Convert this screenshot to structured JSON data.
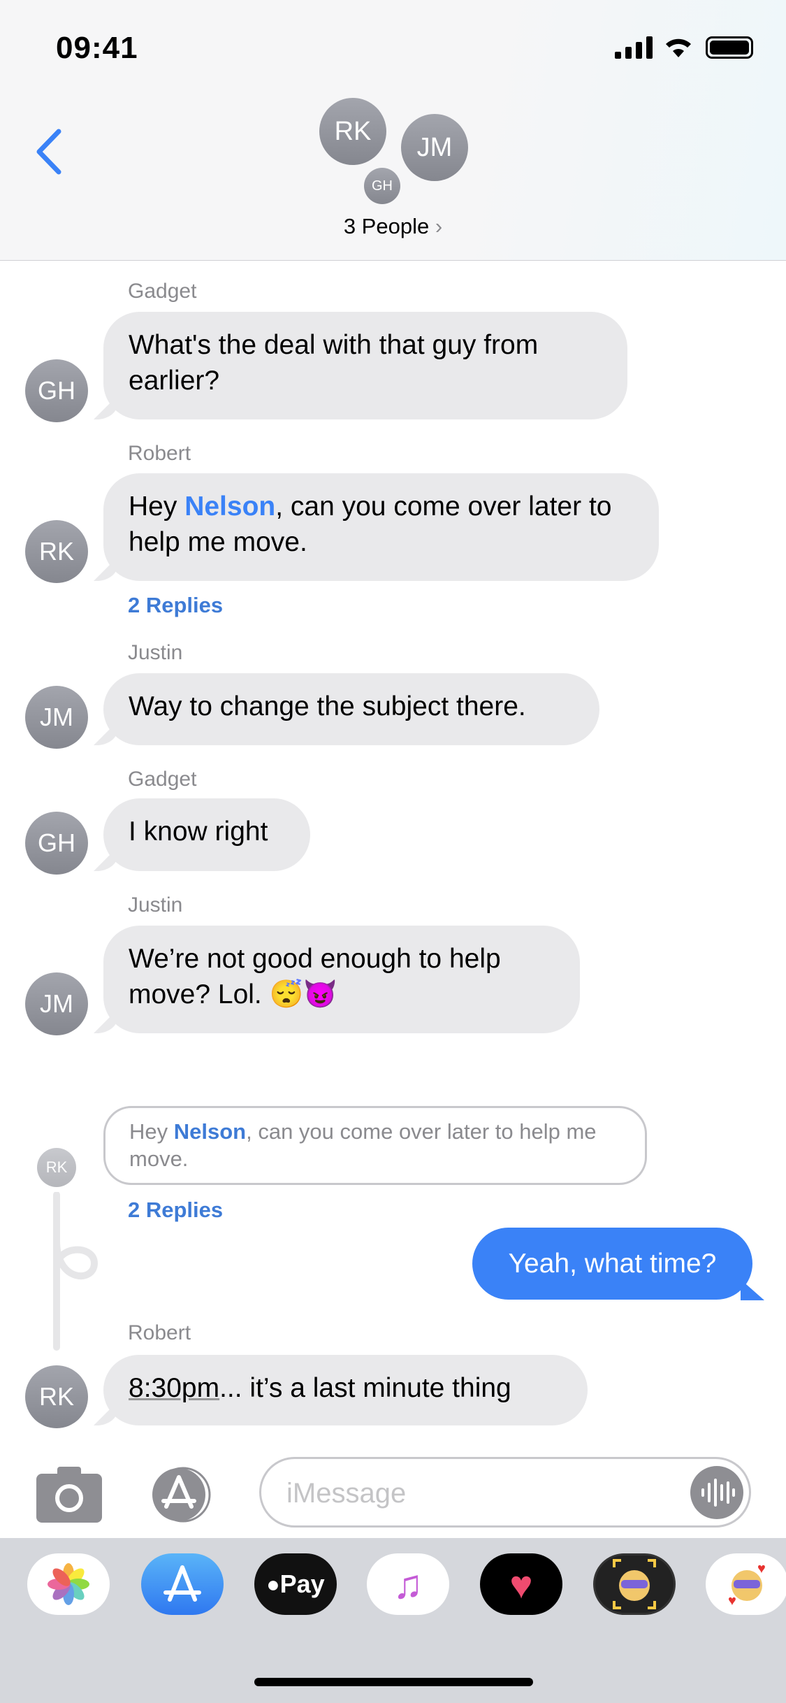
{
  "status_bar": {
    "time": "09:41"
  },
  "header": {
    "avatars": [
      "RK",
      "JM",
      "GH"
    ],
    "title": "3 People",
    "chevron": "chevron-right-icon",
    "back_icon": "chevron-left-icon"
  },
  "messages": [
    {
      "sender": "Gadget",
      "initials": "GH",
      "text": "What's the deal with that guy from earlier?"
    },
    {
      "sender": "Robert",
      "initials": "RK",
      "text_pre": "Hey ",
      "mention": "Nelson",
      "text_post": ", can you come over later to help me move.",
      "replies": "2 Replies"
    },
    {
      "sender": "Justin",
      "initials": "JM",
      "text": "Way to change the subject there."
    },
    {
      "sender": "Gadget",
      "initials": "GH",
      "text": "I know right"
    },
    {
      "sender": "Justin",
      "initials": "JM",
      "text": "We’re not good enough to help move? Lol. 😴😈"
    }
  ],
  "thread": {
    "quoted": {
      "initials": "RK",
      "text_pre": "Hey ",
      "mention": "Nelson",
      "text_post": ", can you come over later to help me move.",
      "replies": "2 Replies"
    },
    "outgoing": "Yeah, what time?",
    "reply": {
      "sender": "Robert",
      "initials": "RK",
      "time_link": "8:30pm",
      "text": "... it’s a last minute thing"
    }
  },
  "input": {
    "placeholder": "iMessage"
  },
  "colors": {
    "accent": "#3a82f7",
    "bubble_gray": "#e9e9eb",
    "tray": "#d5d7dc"
  },
  "app_tray": [
    "photos-icon",
    "app-store-icon",
    "apple-pay-icon",
    "music-icon",
    "digital-touch-icon",
    "memoji-icon",
    "memoji-stickers-icon"
  ],
  "apple_pay_label": "Pay"
}
